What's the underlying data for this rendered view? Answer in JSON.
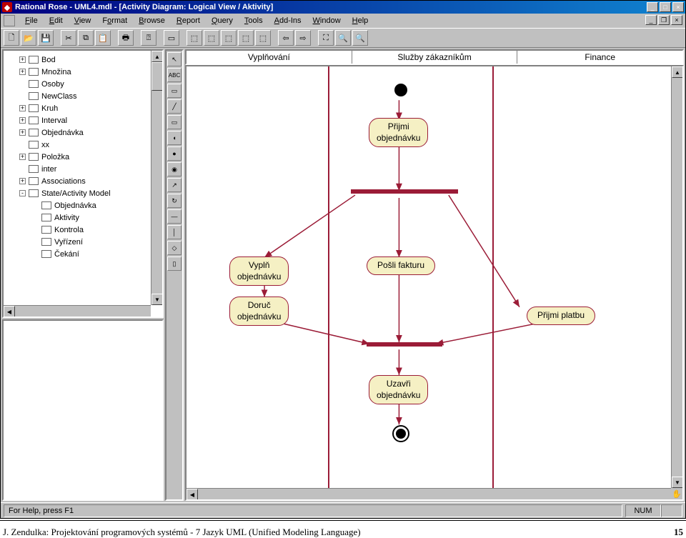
{
  "titlebar": {
    "title": "Rational Rose - UML4.mdl - [Activity Diagram: Logical View / Aktivity]"
  },
  "menu": [
    "File",
    "Edit",
    "View",
    "Format",
    "Browse",
    "Report",
    "Query",
    "Tools",
    "Add-Ins",
    "Window",
    "Help"
  ],
  "tree": {
    "items": [
      {
        "exp": "+",
        "ind": 0,
        "label": "Bod"
      },
      {
        "exp": "+",
        "ind": 0,
        "label": "Množina"
      },
      {
        "exp": "",
        "ind": 0,
        "label": "Osoby"
      },
      {
        "exp": "",
        "ind": 0,
        "label": "NewClass"
      },
      {
        "exp": "+",
        "ind": 0,
        "label": "Kruh"
      },
      {
        "exp": "+",
        "ind": 0,
        "label": "Interval"
      },
      {
        "exp": "+",
        "ind": 0,
        "label": "Objednávka"
      },
      {
        "exp": "",
        "ind": 0,
        "label": "xx"
      },
      {
        "exp": "+",
        "ind": 0,
        "label": "Položka"
      },
      {
        "exp": "",
        "ind": 0,
        "label": "inter"
      },
      {
        "exp": "+",
        "ind": 0,
        "label": "Associations"
      },
      {
        "exp": "-",
        "ind": 0,
        "label": "State/Activity Model"
      },
      {
        "exp": "",
        "ind": 1,
        "label": "Objednávka"
      },
      {
        "exp": "",
        "ind": 1,
        "label": "Aktivity"
      },
      {
        "exp": "",
        "ind": 1,
        "label": "Kontrola"
      },
      {
        "exp": "",
        "ind": 1,
        "label": "Vyřízení"
      },
      {
        "exp": "",
        "ind": 1,
        "label": "Čekání"
      }
    ]
  },
  "swimlanes": [
    "Vyplňování",
    "Služby zákazníkům",
    "Finance"
  ],
  "activities": {
    "a1": "Přijmi\nobjednávku",
    "a2": "Vyplň\nobjednávku",
    "a3": "Pošli fakturu",
    "a4": "Doruč\nobjednávku",
    "a5": "Přijmi platbu",
    "a6": "Uzavři\nobjednávku"
  },
  "statusbar": {
    "help": "For Help, press F1",
    "num": "NUM"
  },
  "footer": {
    "left": "J. Zendulka: Projektování programových systémů - 7 Jazyk UML (Unified Modeling Language)",
    "right": "15"
  }
}
